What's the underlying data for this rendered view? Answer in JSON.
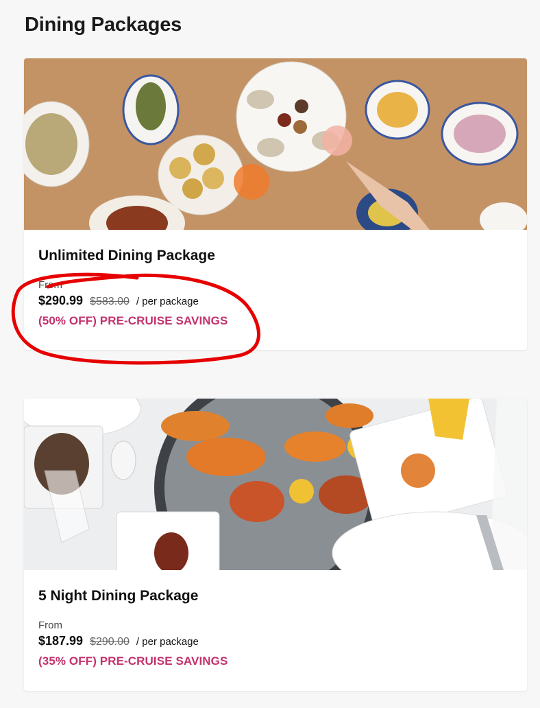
{
  "page": {
    "title": "Dining Packages"
  },
  "packages": [
    {
      "name": "Unlimited Dining Package",
      "from_label": "From",
      "price": "$290.99",
      "original_price": "$583.00",
      "per_label": "/ per package",
      "savings": "(50% OFF) PRE-CRUISE SAVINGS",
      "image": "seafood-oysters-cocktails-photo"
    },
    {
      "name": "5 Night Dining Package",
      "from_label": "From",
      "price": "$187.99",
      "original_price": "$290.00",
      "per_label": "/ per package",
      "savings": "(35% OFF) PRE-CRUISE SAVINGS",
      "image": "seafood-tower-mussels-photo"
    }
  ],
  "colors": {
    "savings": "#c2316c",
    "annotation": "#e60000"
  }
}
